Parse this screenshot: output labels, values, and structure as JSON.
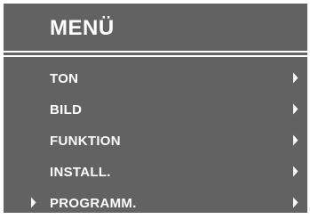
{
  "menu": {
    "title": "MENÜ",
    "items": [
      {
        "label": "TON",
        "selected": false,
        "arrow_icon": "chevron-right-icon"
      },
      {
        "label": "BILD",
        "selected": false,
        "arrow_icon": "chevron-right-icon"
      },
      {
        "label": "FUNKTION",
        "selected": false,
        "arrow_icon": "chevron-right-icon"
      },
      {
        "label": "INSTALL.",
        "selected": false,
        "arrow_icon": "chevron-right-icon"
      },
      {
        "label": "PROGRAMM.",
        "selected": true,
        "arrow_icon": "chevron-right-icon"
      }
    ],
    "selector_icon": "selection-pointer-icon"
  },
  "colors": {
    "panel_background": "#626262",
    "text": "#ffffff",
    "page_background": "#ffffff"
  }
}
